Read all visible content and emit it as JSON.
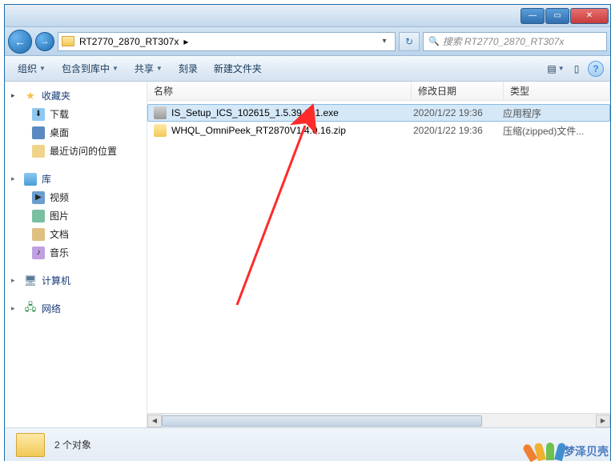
{
  "window": {
    "path_label": "RT2770_2870_RT307x",
    "path_sep": "▸",
    "search_placeholder": "搜索 RT2770_2870_RT307x"
  },
  "toolbar": {
    "organize": "组织",
    "include": "包含到库中",
    "share": "共享",
    "burn": "刻录",
    "new_folder": "新建文件夹"
  },
  "sidebar": {
    "favorites": {
      "label": "收藏夹",
      "items": [
        "下载",
        "桌面",
        "最近访问的位置"
      ]
    },
    "libraries": {
      "label": "库",
      "items": [
        "视频",
        "图片",
        "文档",
        "音乐"
      ]
    },
    "computer": {
      "label": "计算机"
    },
    "network": {
      "label": "网络"
    }
  },
  "columns": {
    "name": "名称",
    "date": "修改日期",
    "type": "类型"
  },
  "files": [
    {
      "name": "IS_Setup_ICS_102615_1.5.39.161.exe",
      "date": "2020/1/22 19:36",
      "type": "应用程序",
      "selected": true,
      "icon": "exe"
    },
    {
      "name": "WHQL_OmniPeek_RT2870V1.4.0.16.zip",
      "date": "2020/1/22 19:36",
      "type": "压缩(zipped)文件...",
      "selected": false,
      "icon": "zip"
    }
  ],
  "details": {
    "count_label": "2 个对象"
  },
  "watermark": "梦泽贝壳"
}
